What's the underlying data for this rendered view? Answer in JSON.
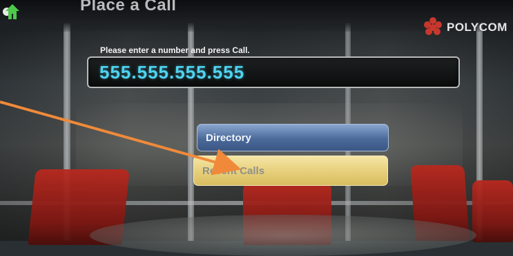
{
  "header": {
    "title": "Place a Call",
    "logo_text": "POLYCOM"
  },
  "dial": {
    "prompt": "Please enter a number and press Call.",
    "number": "555.555.555.555"
  },
  "menu": {
    "directory_label": "Directory",
    "recent_calls_label": "Recent Calls"
  },
  "colors": {
    "number_text": "#4fd3f0",
    "directory_button": "#5b78a8",
    "recent_calls_button": "#e6cf7a",
    "annotation_arrow": "#f08a3a",
    "logo": "#c8372d"
  },
  "icons": {
    "home": "home-icon",
    "logo": "polycom-logo-icon"
  }
}
